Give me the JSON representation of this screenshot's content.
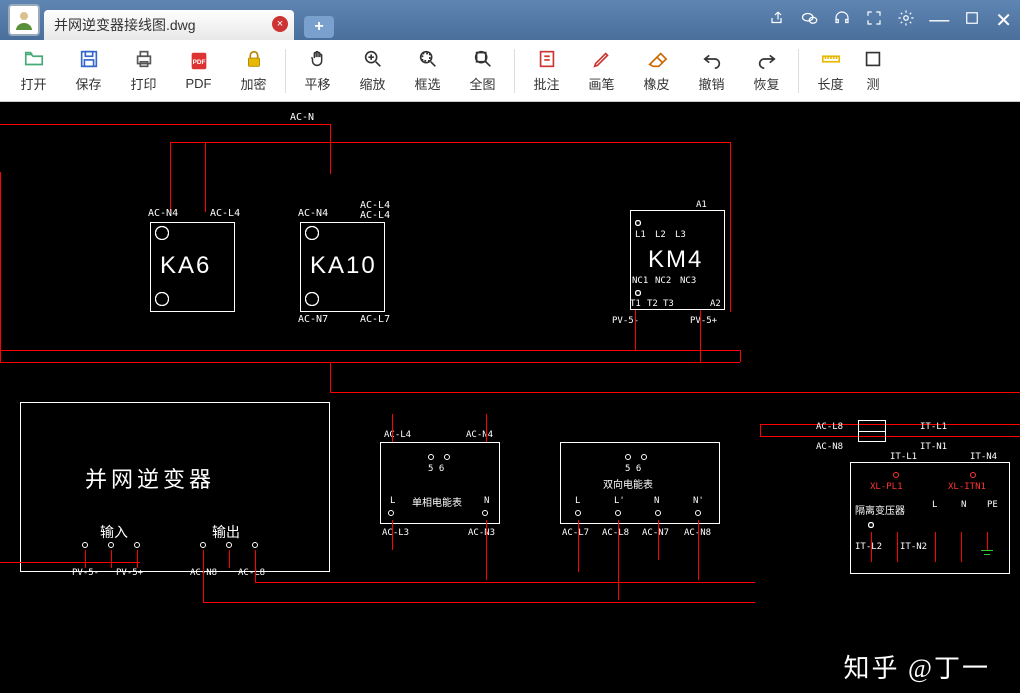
{
  "titlebar": {
    "tab_label": "并网逆变器接线图.dwg"
  },
  "toolbar": {
    "open": "打开",
    "save": "保存",
    "print": "打印",
    "pdf": "PDF",
    "lock": "加密",
    "pan": "平移",
    "zoom": "缩放",
    "box": "框选",
    "fit": "全图",
    "annot": "批注",
    "pen": "画笔",
    "eraser": "橡皮",
    "undo": "撤销",
    "redo": "恢复",
    "length": "长度",
    "meas": "测"
  },
  "labels": {
    "acn": "AC-N",
    "acn4_1": "AC-N4",
    "acl4_1": "AC-L4",
    "acn4_2": "AC-N4",
    "acl4_2": "AC-L4",
    "acl4_2b": "AC-L4",
    "acn7": "AC-N7",
    "acl7": "AC-L7",
    "ka6": "KA6",
    "ka10": "KA10",
    "km4": "KM4",
    "a1": "A1",
    "l1": "L1",
    "l2": "L2",
    "l3": "L3",
    "nc1": "NC1",
    "nc2": "NC2",
    "nc3": "NC3",
    "t1": "T1",
    "t2": "T2",
    "t3": "T3",
    "a2": "A2",
    "pv5m": "PV-5-",
    "pv5p": "PV-5+",
    "inverter": "并网逆变器",
    "input": "输入",
    "output": "输出",
    "pv5m2": "PV-5-",
    "pv5p2": "PV-5+",
    "acn8": "AC-N8",
    "acl8": "AC-L8",
    "acl4_3": "AC-L4",
    "acn4_3": "AC-N4",
    "meter1": "单相电能表",
    "meter2": "双向电能表",
    "mL": "L",
    "mR": "N",
    "m56": "5 6",
    "dL": "L",
    "dLp": "L'",
    "dN": "N",
    "dNp": "N'",
    "d56": "5 6",
    "acl3": "AC-L3",
    "acn3": "AC-N3",
    "acl7b": "AC-L7",
    "acl8b": "AC-L8",
    "acn7b": "AC-N7",
    "acn8b": "AC-N8",
    "acl8c": "AC-L8",
    "acn8c": "AC-N8",
    "itl1": "IT-L1",
    "itn1": "IT-N1",
    "itl1b": "IT-L1",
    "itn4": "IT-N4",
    "itl2": "IT-L2",
    "itn2": "IT-N2",
    "transformer": "隔离变压器",
    "trL": "L",
    "trN": "N",
    "trPE": "PE",
    "xfpl": "XL-PL1",
    "xft": "XL-ITN1"
  },
  "watermark": "知乎 @丁一"
}
